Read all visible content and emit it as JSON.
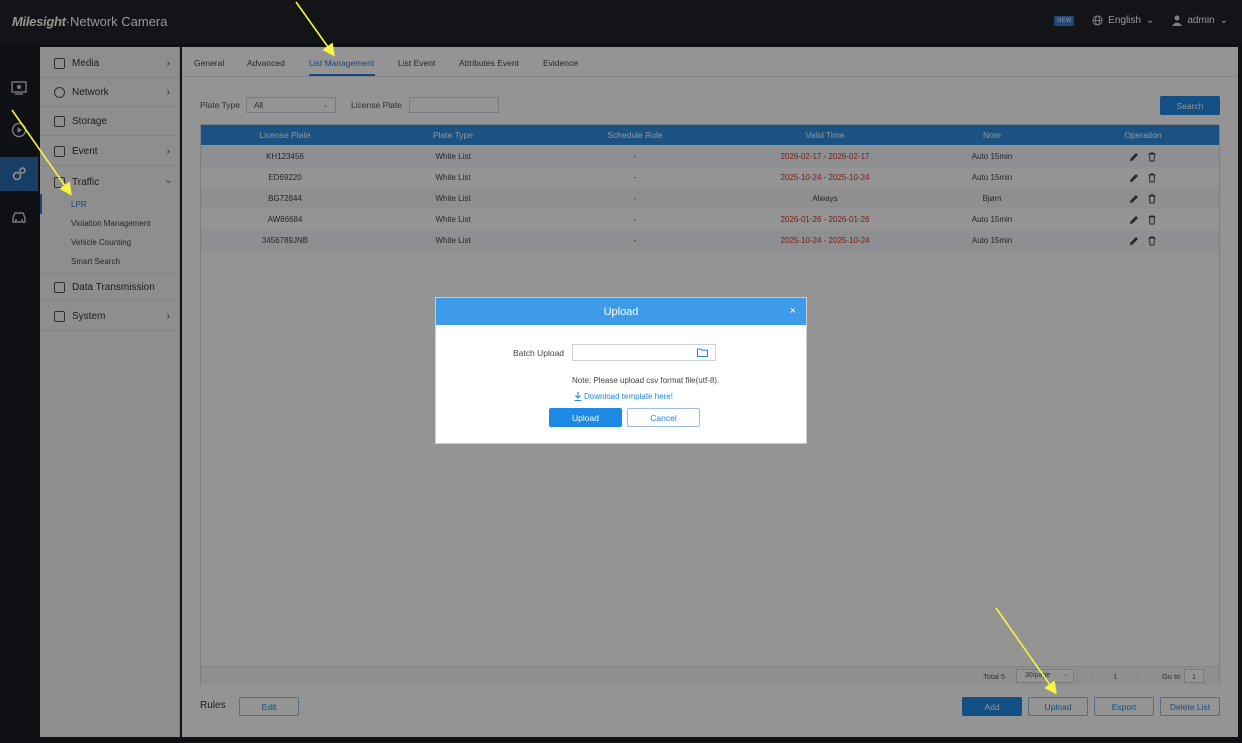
{
  "app": {
    "brand_logo": "Milesight",
    "brand_suffix": "·Network Camera",
    "new_badge": "NEW",
    "language": "English",
    "user": "admin"
  },
  "rail": [
    {
      "icon": "live-view-icon"
    },
    {
      "icon": "playback-icon"
    },
    {
      "icon": "settings-icon"
    },
    {
      "icon": "vehicle-icon"
    }
  ],
  "sidebar": {
    "items": [
      {
        "label": "Media",
        "icon": "media-icon"
      },
      {
        "label": "Network",
        "icon": "globe-icon"
      },
      {
        "label": "Storage",
        "icon": "storage-icon"
      },
      {
        "label": "Event",
        "icon": "event-icon"
      },
      {
        "label": "Traffic",
        "icon": "car-icon"
      },
      {
        "label": "Data Transmission",
        "icon": "layers-icon"
      },
      {
        "label": "System",
        "icon": "system-icon"
      }
    ],
    "traffic_sub": [
      "LPR",
      "Violation Management",
      "Vehicle Counting",
      "Smart Search"
    ]
  },
  "tabs": [
    "General",
    "Advanced",
    "List Management",
    "List Event",
    "Attributes Event",
    "Evidence"
  ],
  "filters": {
    "plate_type_label": "Plate Type",
    "plate_type_value": "All",
    "license_plate_label": "License Plate",
    "license_plate_value": "",
    "search_label": "Search"
  },
  "table": {
    "columns": [
      "License Plate",
      "Plate Type",
      "Schedule Rule",
      "Valid Time",
      "Note",
      "Operation"
    ],
    "rows": [
      {
        "plate": "KH123456",
        "type": "White List",
        "rule": "-",
        "valid": "2026-02-17 - 2026-02-17",
        "note": "Auto 15min",
        "valid_red": true
      },
      {
        "plate": "ED69220",
        "type": "White List",
        "rule": "-",
        "valid": "2025-10-24 - 2025-10-24",
        "note": "Auto 15min",
        "valid_red": true
      },
      {
        "plate": "BG72844",
        "type": "White List",
        "rule": "-",
        "valid": "Always",
        "note": "Bjørn",
        "valid_red": false
      },
      {
        "plate": "AW86684",
        "type": "White List",
        "rule": "-",
        "valid": "2026-01-26 - 2026-01-26",
        "note": "Auto 15min",
        "valid_red": true
      },
      {
        "plate": "3456789JNB",
        "type": "White List",
        "rule": "-",
        "valid": "2025-10-24 - 2025-10-24",
        "note": "Auto 15min",
        "valid_red": true
      }
    ]
  },
  "pager": {
    "total": "Total 5",
    "per_page": "30/page",
    "page": "1",
    "goto_label": "Go to",
    "goto_value": "1"
  },
  "footer": {
    "rules_label": "Rules",
    "edit_label": "Edit",
    "add_label": "Add",
    "upload_label": "Upload",
    "export_label": "Export",
    "delete_label": "Delete List"
  },
  "modal": {
    "title": "Upload",
    "close": "×",
    "batch_label": "Batch Upload",
    "file_value": "",
    "note": "Note: Please upload csv format file(utf-8).",
    "download_link": "Download template here!",
    "upload_btn": "Upload",
    "cancel_btn": "Cancel"
  },
  "colors": {
    "accent": "#1e88e5",
    "header": "#2e8fe2",
    "annotation_arrow": "#f5f542",
    "expired": "#d32f2f"
  }
}
